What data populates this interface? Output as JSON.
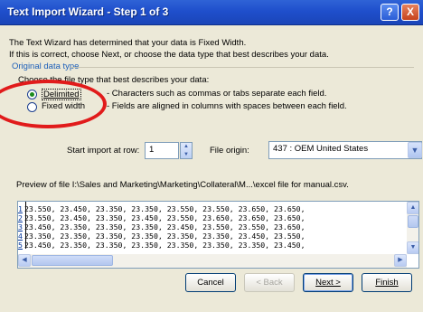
{
  "window": {
    "title": "Text Import Wizard - Step 1 of 3"
  },
  "titlebar_buttons": {
    "help": "?",
    "close": "X"
  },
  "intro": {
    "line1": "The Text Wizard has determined that your data is Fixed Width.",
    "line2": "If this is correct, choose Next, or choose the data type that best describes your data."
  },
  "original_data_type": {
    "group_label": "Original data type",
    "prompt": "Choose the file type that best describes your data:",
    "options": [
      {
        "label": "Delimited",
        "description": "- Characters such as commas or tabs separate each field.",
        "selected": true
      },
      {
        "label": "Fixed width",
        "description": "- Fields are aligned in columns with spaces between each field.",
        "selected": false
      }
    ]
  },
  "start_import": {
    "label": "Start import at row:",
    "value": "1"
  },
  "file_origin": {
    "label": "File origin:",
    "value": "437 : OEM United States"
  },
  "preview": {
    "label": "Preview of file I:\\Sales and Marketing\\Marketing\\Collateral\\M...\\excel file for manual.csv.",
    "rows": [
      {
        "num": "1",
        "text": "23.550, 23.450, 23.350, 23.350, 23.550, 23.550, 23.650, 23.650,"
      },
      {
        "num": "2",
        "text": "23.550, 23.450, 23.350, 23.450, 23.550, 23.650, 23.650, 23.650,"
      },
      {
        "num": "3",
        "text": "23.450, 23.350, 23.350, 23.350, 23.450, 23.550, 23.550, 23.650,"
      },
      {
        "num": "4",
        "text": "23.350, 23.350, 23.350, 23.350, 23.350, 23.350, 23.450, 23.550,"
      },
      {
        "num": "5",
        "text": "23.450, 23.350, 23.350, 23.350, 23.350, 23.350, 23.350, 23.450,"
      }
    ]
  },
  "buttons": {
    "cancel": "Cancel",
    "back": "< Back",
    "next": "Next >",
    "finish": "Finish"
  },
  "annotation": {
    "color": "#e11b1b"
  }
}
